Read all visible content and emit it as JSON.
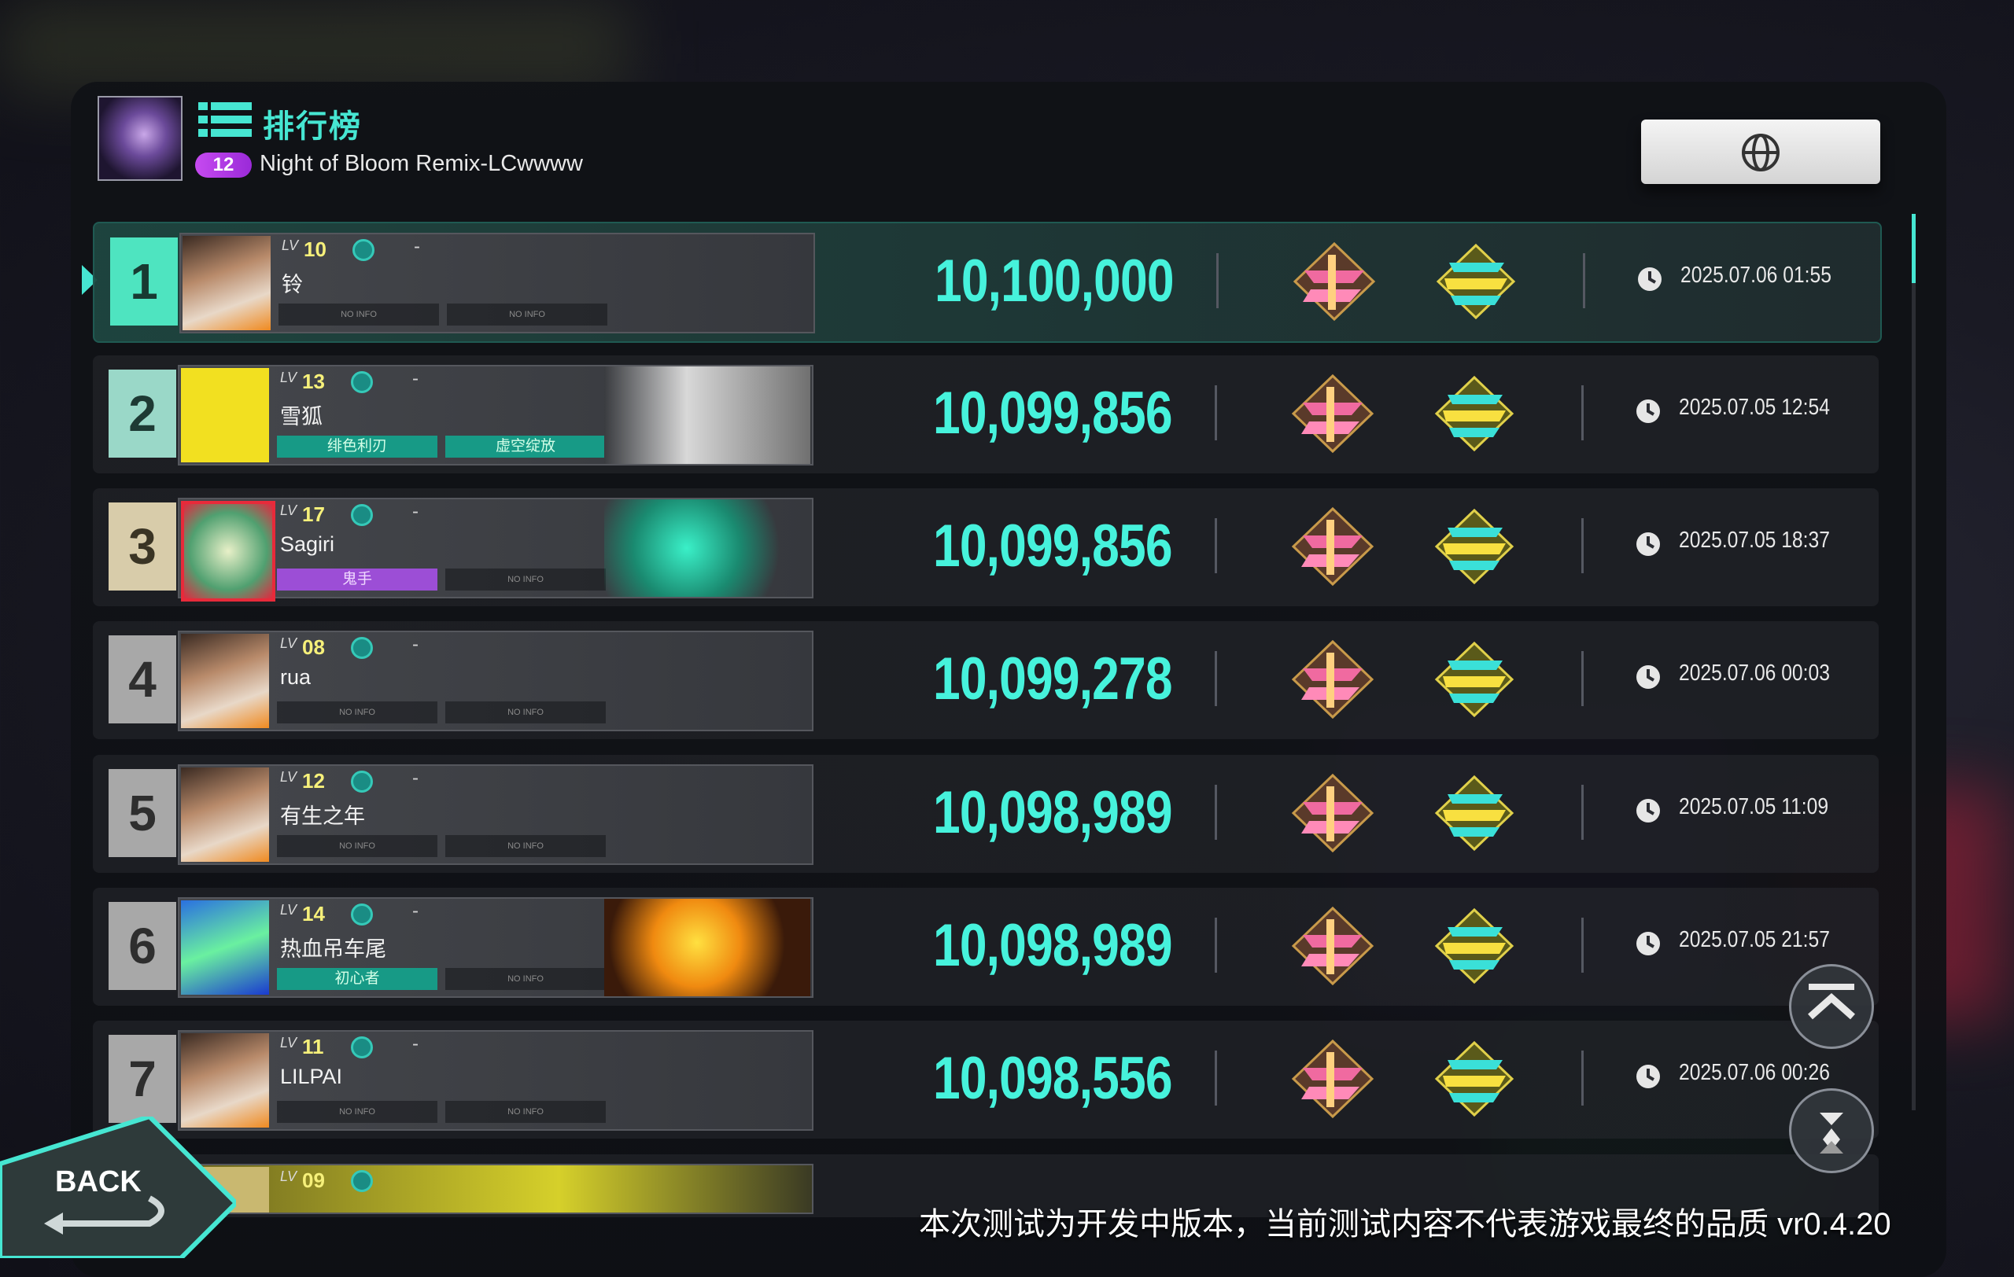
{
  "header": {
    "title": "排行榜",
    "level": "12",
    "song": "Night of Bloom Remix-LCwwww"
  },
  "rows": [
    {
      "rank": "1",
      "lv_label": "LV",
      "lv": "10",
      "name": "铃",
      "dash": "-",
      "score": "10,100,000",
      "datetime": "2025.07.06 01:55",
      "tags": []
    },
    {
      "rank": "2",
      "lv_label": "LV",
      "lv": "13",
      "name": "雪狐",
      "dash": "-",
      "score": "10,099,856",
      "datetime": "2025.07.05 12:54",
      "tags": [
        "绯色利刃",
        "虚空绽放"
      ]
    },
    {
      "rank": "3",
      "lv_label": "LV",
      "lv": "17",
      "name": "Sagiri",
      "dash": "-",
      "score": "10,099,856",
      "datetime": "2025.07.05 18:37",
      "tags": [
        "鬼手"
      ]
    },
    {
      "rank": "4",
      "lv_label": "LV",
      "lv": "08",
      "name": "rua",
      "dash": "-",
      "score": "10,099,278",
      "datetime": "2025.07.06 00:03",
      "tags": []
    },
    {
      "rank": "5",
      "lv_label": "LV",
      "lv": "12",
      "name": "有生之年",
      "dash": "-",
      "score": "10,098,989",
      "datetime": "2025.07.05 11:09",
      "tags": []
    },
    {
      "rank": "6",
      "lv_label": "LV",
      "lv": "14",
      "name": "热血吊车尾",
      "dash": "-",
      "score": "10,098,989",
      "datetime": "2025.07.05 21:57",
      "tags": [
        "初心者"
      ]
    },
    {
      "rank": "7",
      "lv_label": "LV",
      "lv": "11",
      "name": "LILPAI",
      "dash": "-",
      "score": "10,098,556",
      "datetime": "2025.07.06 00:26",
      "tags": []
    }
  ],
  "partial_row": {
    "lv_label": "LV",
    "lv": "09"
  },
  "card_placeholder": "NO INFO",
  "back_label": "BACK",
  "notice": "本次测试为开发中版本，当前测试内容不代表游戏最终的品质 vr0.4.20",
  "colors": {
    "accent": "#46e6d2",
    "score": "#46f2dc",
    "level_pill": "#c64af0"
  },
  "icons": {
    "globe": "globe-icon",
    "leaderboard": "list-icon",
    "clock": "clock-icon",
    "scroll_top": "double-chevron-up-icon",
    "locate": "locate-me-icon"
  }
}
